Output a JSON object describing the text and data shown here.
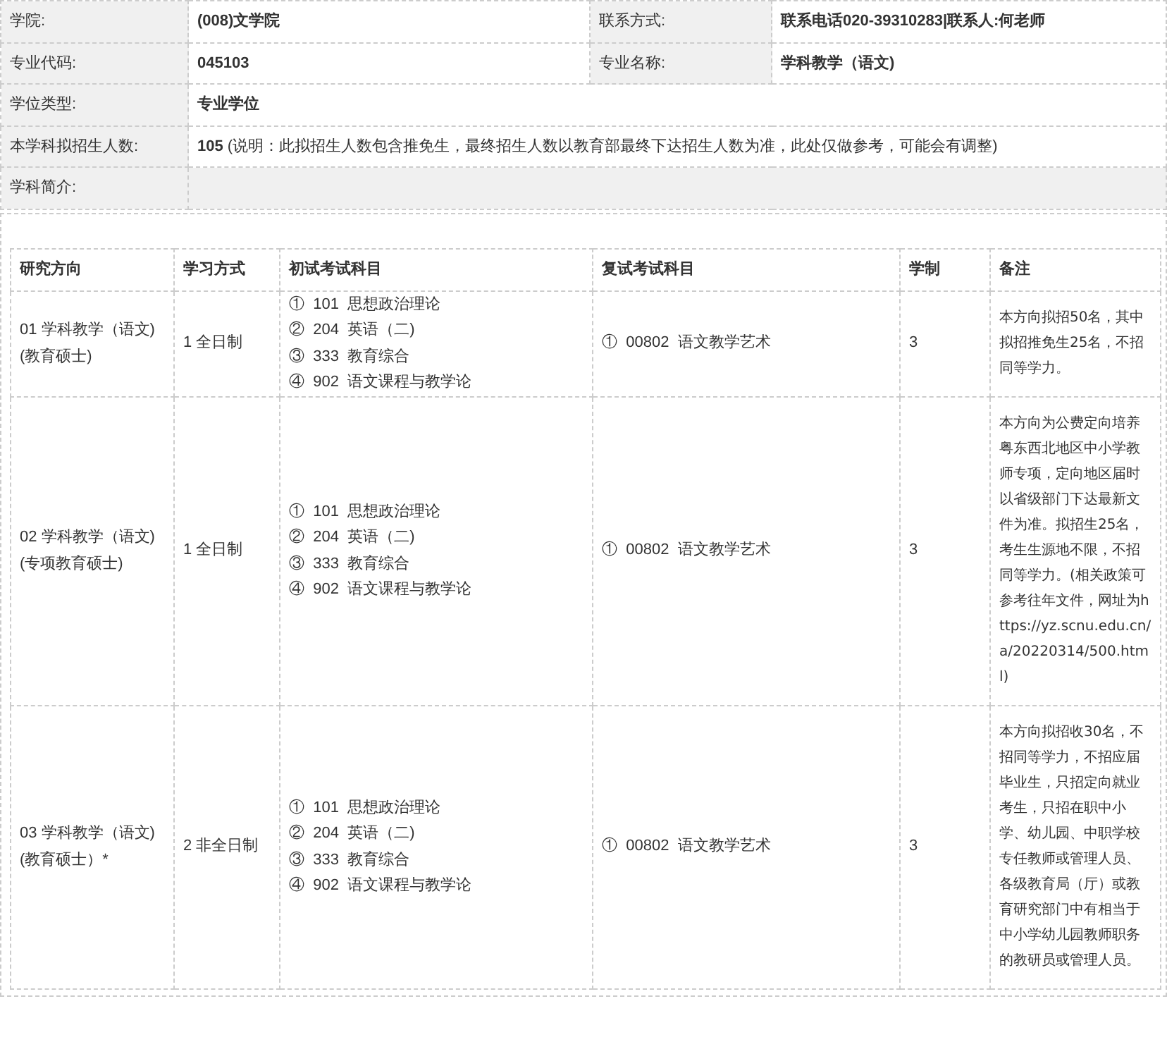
{
  "info": [
    {
      "label": "学院:",
      "value": "(008)文学院",
      "label2": "联系方式:",
      "value2": "联系电话020-39310283|联系人:何老师"
    },
    {
      "label": "专业代码:",
      "value": "045103",
      "label2": "专业名称:",
      "value2": "学科教学（语文)"
    },
    {
      "label": "学位类型:",
      "value": "专业学位"
    },
    {
      "label": "本学科拟招生人数:",
      "value": "**105** (说明：此拟招生人数包含推免生，最终招生人数以教育部最终下达招生人数为准，此处仅做参考，可能会有调整)"
    },
    {
      "label": "学科简介:"
    }
  ],
  "table": {
    "columns": [
      "研究方向",
      "学习方式",
      "初试考试科目",
      "复试考试科目",
      "学制",
      "备注"
    ],
    "rows": [
      {
        "direction": [
          "01 学科教学（语文)",
          "(教育硕士)"
        ],
        "mode": "1 全日制",
        "first": [
          [
            "①",
            "101",
            "思想政治理论"
          ],
          [
            "②",
            "204",
            "英语（二)"
          ],
          [
            "③",
            "333",
            "教育综合"
          ],
          [
            "④",
            "902",
            "语文课程与教学论"
          ]
        ],
        "second": [
          [
            "①",
            "00802",
            "语文教学艺术"
          ]
        ],
        "years": "3",
        "note": "本方向拟招50名，其中拟招推免生25名，不招同等学力。"
      },
      {
        "direction": [
          "02 学科教学（语文)",
          "(专项教育硕士)"
        ],
        "mode": "1 全日制",
        "first": [
          [
            "①",
            "101",
            "思想政治理论"
          ],
          [
            "②",
            "204",
            "英语（二)"
          ],
          [
            "③",
            "333",
            "教育综合"
          ],
          [
            "④",
            "902",
            "语文课程与教学论"
          ]
        ],
        "second": [
          [
            "①",
            "00802",
            "语文教学艺术"
          ]
        ],
        "years": "3",
        "note": "本方向为公费定向培养粤东西北地区中小学教师专项，定向地区届时以省级部门下达最新文件为准。拟招生25名，考生生源地不限，不招同等学力。(相关政策可参考往年文件，网址为https://yz.scnu.edu.cn/a/20220314/500.html)"
      },
      {
        "direction": [
          "03 学科教学（语文)",
          "(教育硕士）*"
        ],
        "mode": "2 非全日制",
        "first": [
          [
            "①",
            "101",
            "思想政治理论"
          ],
          [
            "②",
            "204",
            "英语（二)"
          ],
          [
            "③",
            "333",
            "教育综合"
          ],
          [
            "④",
            "902",
            "语文课程与教学论"
          ]
        ],
        "second": [
          [
            "①",
            "00802",
            "语文教学艺术"
          ]
        ],
        "years": "3",
        "note": "本方向拟招收30名，不招同等学力，不招应届毕业生，只招定向就业考生，只招在职中小学、幼儿园、中职学校专任教师或管理人员、各级教育局（厅）或教育研究部门中有相当于中小学幼儿园教师职务的教研员或管理人员。"
      }
    ]
  }
}
